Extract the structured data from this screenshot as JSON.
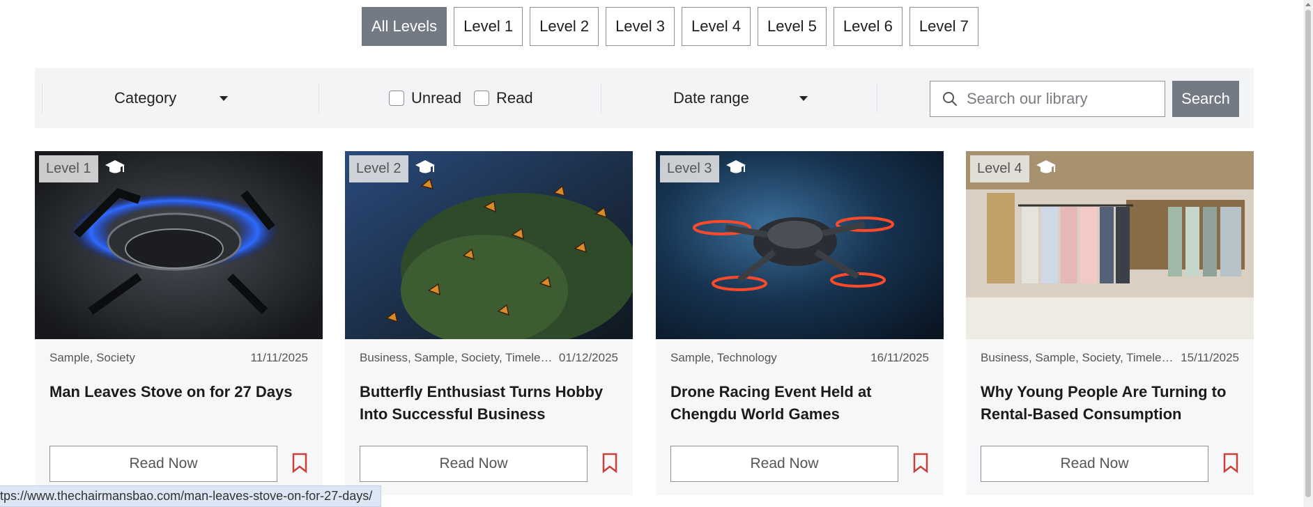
{
  "levels": [
    "All Levels",
    "Level 1",
    "Level 2",
    "Level 3",
    "Level 4",
    "Level 5",
    "Level 6",
    "Level 7"
  ],
  "active_level": "All Levels",
  "filters": {
    "category_label": "Category",
    "unread_label": "Unread",
    "read_label": "Read",
    "date_range_label": "Date range",
    "search_placeholder": "Search our library",
    "search_button": "Search"
  },
  "cards": [
    {
      "level": "Level 1",
      "categories": "Sample, Society",
      "date": "11/11/2025",
      "title": "Man Leaves Stove on for 27 Days",
      "read_label": "Read Now"
    },
    {
      "level": "Level 2",
      "categories": "Business, Sample, Society, Timeless...",
      "date": "01/12/2025",
      "title": "Butterfly Enthusiast Turns Hobby Into Successful Business",
      "read_label": "Read Now"
    },
    {
      "level": "Level 3",
      "categories": "Sample, Technology",
      "date": "16/11/2025",
      "title": "Drone Racing Event Held at Chengdu World Games",
      "read_label": "Read Now"
    },
    {
      "level": "Level 4",
      "categories": "Business, Sample, Society, Timeless...",
      "date": "15/11/2025",
      "title": "Why Young People Are Turning to Rental-Based Consumption",
      "read_label": "Read Now"
    }
  ],
  "status_url": "tps://www.thechairmansbao.com/man-leaves-stove-on-for-27-days/",
  "colors": {
    "accent": "#737a84",
    "bookmark": "#c8413b",
    "panel": "#f3f4f6"
  }
}
